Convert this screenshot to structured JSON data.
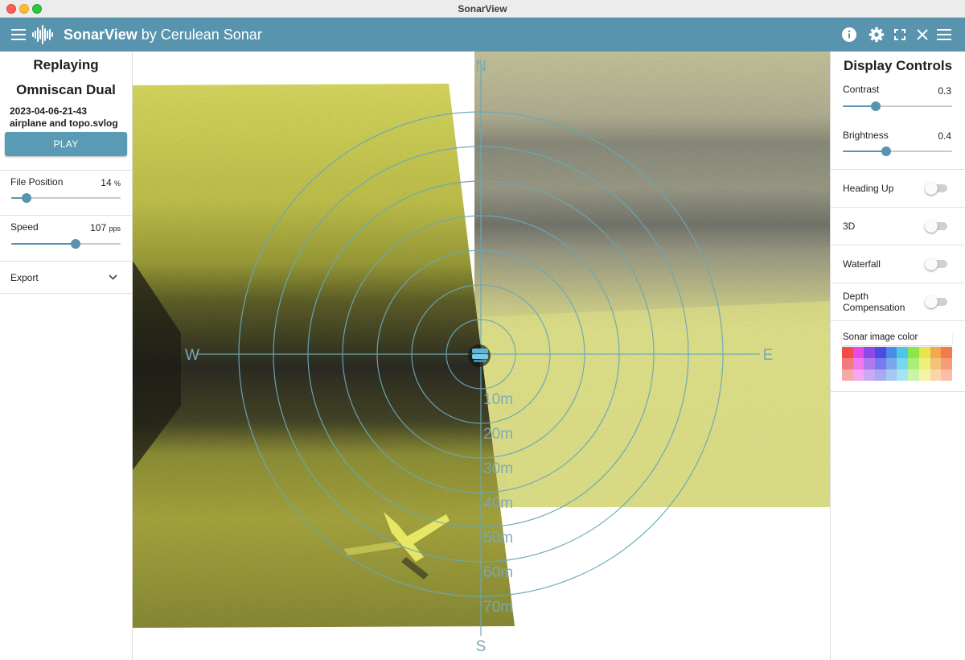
{
  "window": {
    "title": "SonarView"
  },
  "appbar": {
    "title_bold": "SonarView",
    "title_rest": " by Cerulean Sonar"
  },
  "left": {
    "status": "Replaying",
    "device": "Omniscan Dual",
    "filename": "2023-04-06-21-43 airplane and topo.svlog",
    "play_label": "PLAY",
    "file_position": {
      "label": "File Position",
      "value": "14",
      "unit": "%",
      "fraction": 0.14
    },
    "speed": {
      "label": "Speed",
      "value": "107",
      "unit": "pps",
      "fraction": 0.59
    },
    "export": {
      "label": "Export"
    }
  },
  "sonar": {
    "compass": {
      "n": "N",
      "s": "S",
      "e": "E",
      "w": "W"
    },
    "ranges": [
      "10m",
      "20m",
      "30m",
      "40m",
      "50m",
      "60m",
      "70m"
    ],
    "colors": {
      "sonar": "#e6e890",
      "grid": "#6aa8b8"
    }
  },
  "right": {
    "title": "Display Controls",
    "contrast": {
      "label": "Contrast",
      "value": "0.3",
      "fraction": 0.3
    },
    "brightness": {
      "label": "Brightness",
      "value": "0.4",
      "fraction": 0.4
    },
    "heading_up": {
      "label": "Heading Up",
      "on": false
    },
    "three_d": {
      "label": "3D",
      "on": false
    },
    "waterfall": {
      "label": "Waterfall",
      "on": false
    },
    "depth_comp": {
      "label": "Depth Compensation",
      "on": false
    },
    "sonar_color": {
      "label": "Sonar image color",
      "palette": [
        "#f24b4b",
        "#e64be6",
        "#8c4be6",
        "#4b4be6",
        "#4b8ce6",
        "#4bc8e6",
        "#8ce64b",
        "#e6e64b",
        "#f2a84b",
        "#f27a4b",
        "#f27a7a",
        "#ef7aef",
        "#ad7aef",
        "#7a7aef",
        "#7aa8ef",
        "#7ad5ef",
        "#aaef7a",
        "#efef7a",
        "#f5c07a",
        "#f59c7a",
        "#f5aaaa",
        "#f4a8f4",
        "#cba8f4",
        "#a8a8f4",
        "#a8c8f4",
        "#a8e3f4",
        "#c8f4a8",
        "#f4f4a8",
        "#f8d6a8",
        "#f8bea8"
      ]
    }
  }
}
